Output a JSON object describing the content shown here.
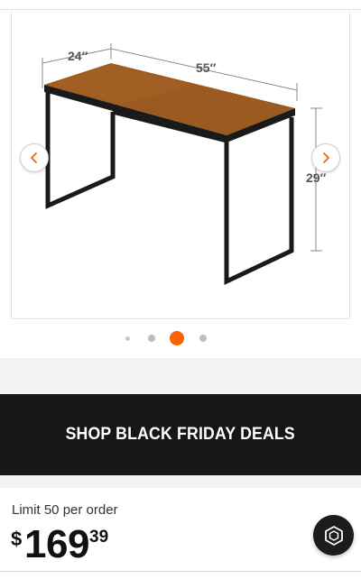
{
  "gallery": {
    "image_alt": "Metal frame desk with walnut-finish top, dimension callouts",
    "dimensions": {
      "depth": "24″",
      "width": "55″",
      "height": "29″"
    },
    "prev_icon": "chevron-left-icon",
    "next_icon": "chevron-right-icon",
    "pagination": {
      "total": 4,
      "active_index": 3
    }
  },
  "promo": {
    "label": "SHOP BLACK FRIDAY DEALS"
  },
  "pricing": {
    "limit_text": "Limit 50 per order",
    "currency_symbol": "$",
    "dollars": "169",
    "cents": "39"
  },
  "fab": {
    "icon": "hexagon-chat-icon"
  },
  "colors": {
    "accent_orange": "#f96302",
    "desk_top": "#9b5a1f",
    "frame": "#1a1a1a",
    "banner_bg": "#161616"
  }
}
